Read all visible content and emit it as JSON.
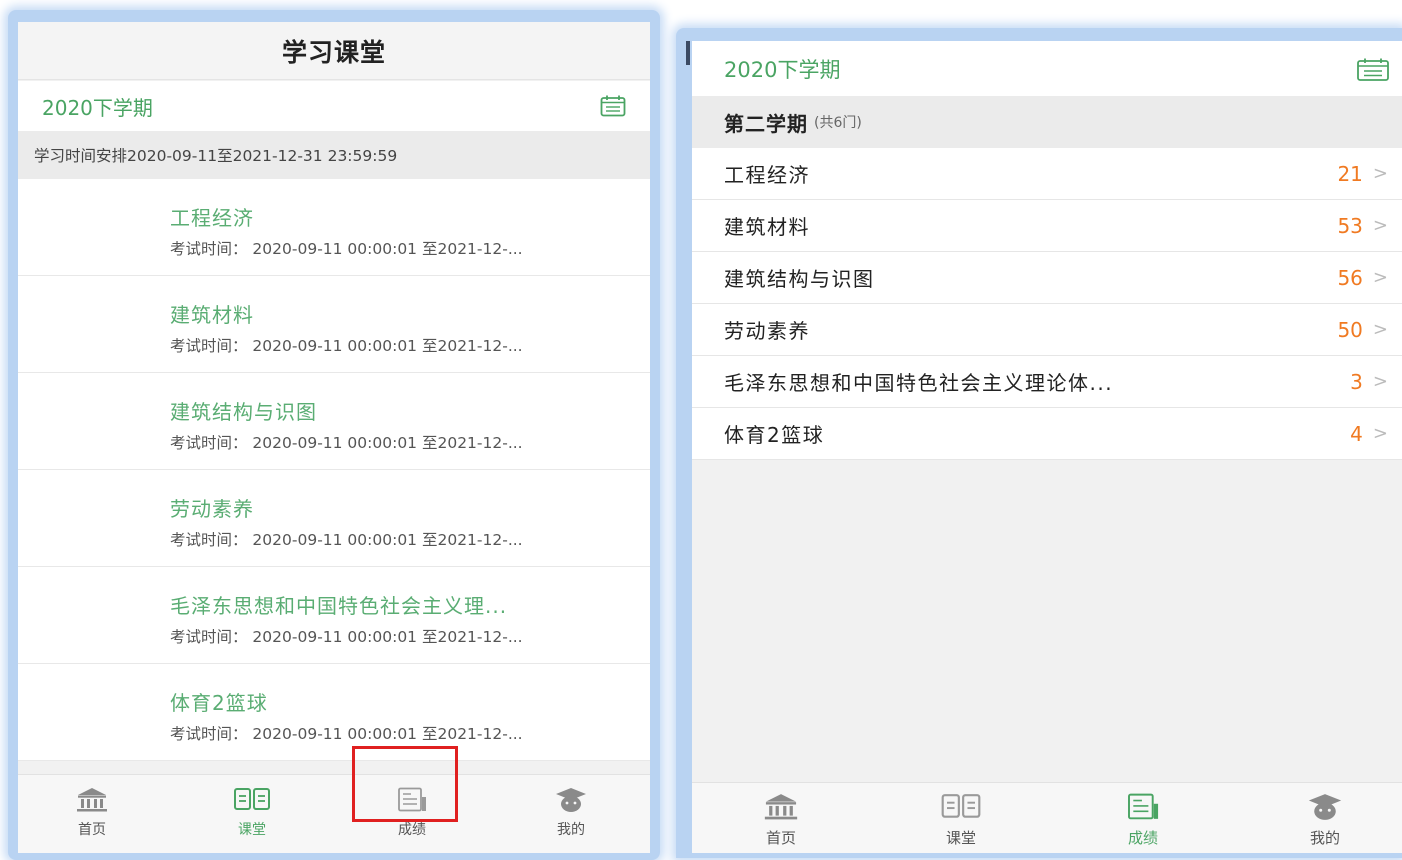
{
  "left": {
    "title": "学习课堂",
    "term": "2020下学期",
    "schedule": "学习时间安排2020-09-11至2021-12-31 23:59:59",
    "courses": [
      {
        "name": "工程经济",
        "time": "考试时间：  2020-09-11 00:00:01 至2021-12-..."
      },
      {
        "name": "建筑材料",
        "time": "考试时间：  2020-09-11 00:00:01 至2021-12-..."
      },
      {
        "name": "建筑结构与识图",
        "time": "考试时间：  2020-09-11 00:00:01 至2021-12-..."
      },
      {
        "name": "劳动素养",
        "time": "考试时间：  2020-09-11 00:00:01 至2021-12-..."
      },
      {
        "name": "毛泽东思想和中国特色社会主义理...",
        "time": "考试时间：  2020-09-11 00:00:01 至2021-12-..."
      },
      {
        "name": "体育2篮球",
        "time": "考试时间：  2020-09-11 00:00:01 至2021-12-..."
      }
    ],
    "tabs": [
      {
        "label": "首页",
        "icon": "bank-icon"
      },
      {
        "label": "课堂",
        "icon": "book-icon"
      },
      {
        "label": "成绩",
        "icon": "report-icon"
      },
      {
        "label": "我的",
        "icon": "graduate-cap-icon"
      }
    ],
    "active_tab": "课堂"
  },
  "right": {
    "term": "2020下学期",
    "semester": "第二学期",
    "count": "(共6门)",
    "grades": [
      {
        "name": "工程经济",
        "score": "21"
      },
      {
        "name": "建筑材料",
        "score": "53"
      },
      {
        "name": "建筑结构与识图",
        "score": "56"
      },
      {
        "name": "劳动素养",
        "score": "50"
      },
      {
        "name": "毛泽东思想和中国特色社会主义理论体...",
        "score": "3"
      },
      {
        "name": "体育2篮球",
        "score": "4"
      }
    ],
    "tabs": [
      {
        "label": "首页",
        "icon": "bank-icon"
      },
      {
        "label": "课堂",
        "icon": "book-icon"
      },
      {
        "label": "成绩",
        "icon": "report-icon"
      },
      {
        "label": "我的",
        "icon": "graduate-cap-icon"
      }
    ],
    "active_tab": "成绩"
  },
  "colors": {
    "green": "#4aa463",
    "score_orange": "#f07a22",
    "highlight_red": "#e02020",
    "frame_blue": "#b9d3f2"
  }
}
